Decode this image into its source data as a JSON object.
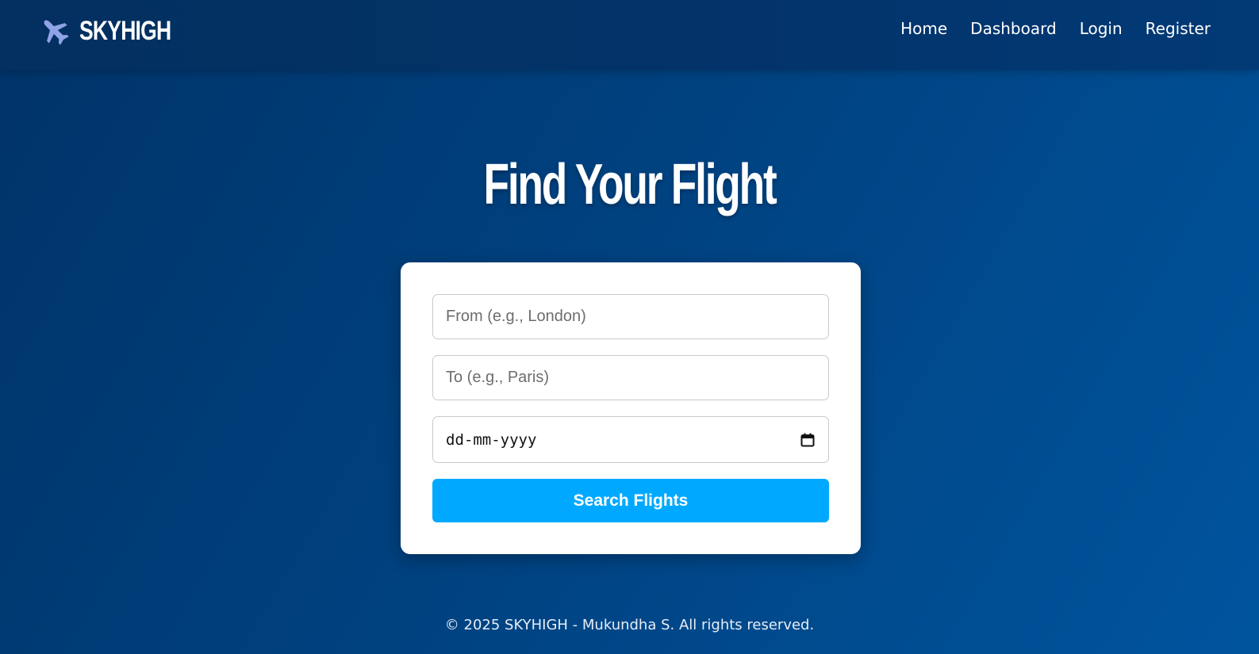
{
  "navbar": {
    "brand_icon": "airplane-icon",
    "brand_name": "SKYHIGH",
    "links": [
      {
        "label": "Home"
      },
      {
        "label": "Dashboard"
      },
      {
        "label": "Login"
      },
      {
        "label": "Register"
      }
    ]
  },
  "hero": {
    "title": "Find Your Flight"
  },
  "search_form": {
    "from_placeholder": "From (e.g., London)",
    "to_placeholder": "To (e.g., Paris)",
    "date_placeholder": "dd-mm-yyyy",
    "date_icon": "calendar-icon",
    "submit_label": "Search Flights"
  },
  "footer": {
    "text": "© 2025 SKYHIGH - Mukundha S. All rights reserved."
  },
  "colors": {
    "background": "#00417f",
    "navbar": "#03336a",
    "button": "#00a9ff",
    "card": "#ffffff",
    "plane_icon": "#8fa3e8"
  }
}
